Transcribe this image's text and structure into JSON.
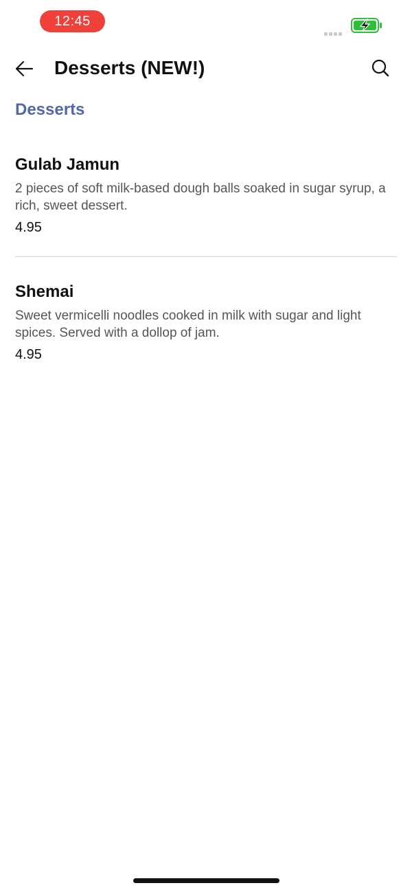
{
  "status_bar": {
    "time": "12:45",
    "battery_color": "#2dbf3a",
    "battery_icon": "battery-charging-icon",
    "signal_icon": "signal-icon"
  },
  "header": {
    "title": "Desserts (NEW!)",
    "back_icon": "arrow-left-icon",
    "search_icon": "search-icon"
  },
  "category": {
    "title": "Desserts",
    "color": "#5468a6"
  },
  "items": [
    {
      "name": "Gulab Jamun",
      "description": "2 pieces of soft milk-based dough balls soaked in sugar syrup, a rich, sweet dessert.",
      "price": "4.95"
    },
    {
      "name": "Shemai",
      "description": "Sweet vermicelli noodles cooked in milk with sugar and light spices. Served with a dollop of jam.",
      "price": "4.95"
    }
  ]
}
